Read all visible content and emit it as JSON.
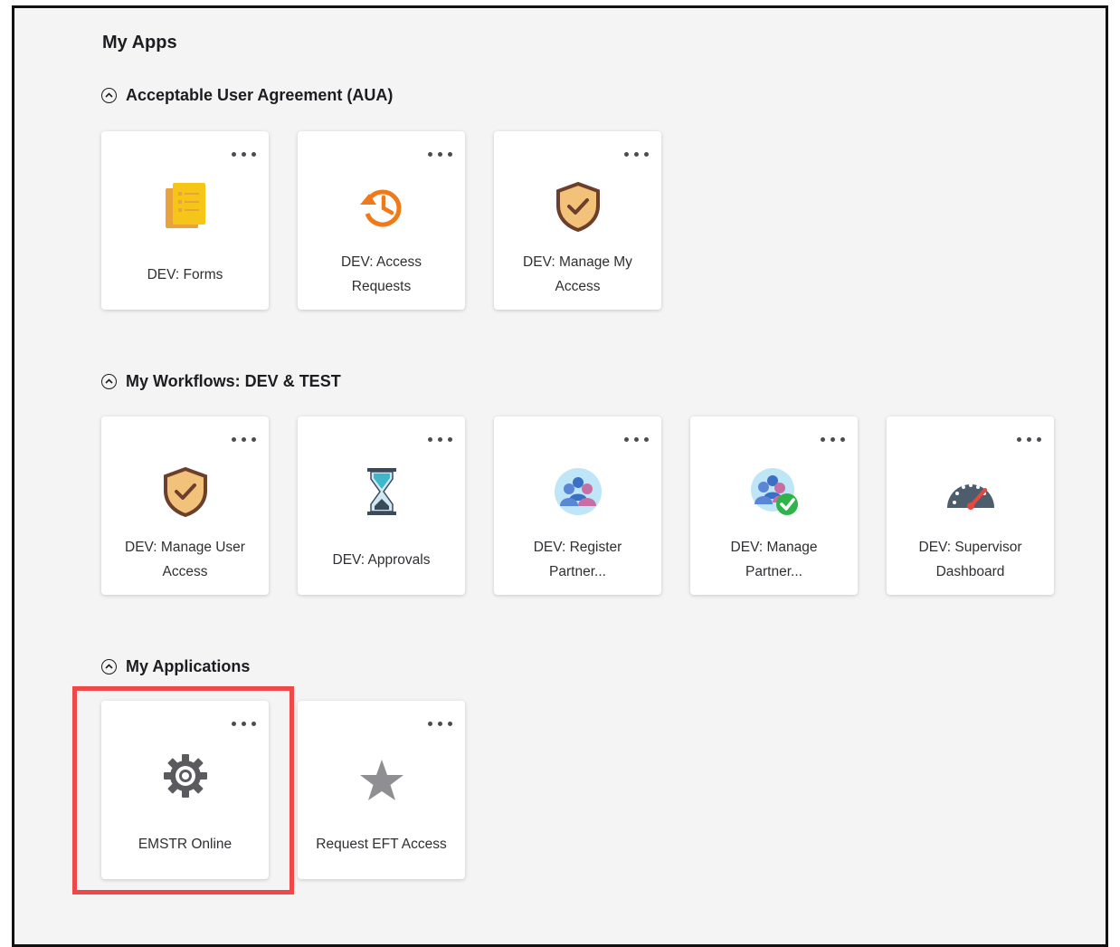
{
  "page_title": "My Apps",
  "sections": [
    {
      "title": "Acceptable User Agreement (AUA)",
      "apps": [
        {
          "label": "DEV: Forms",
          "icon": "forms-icon"
        },
        {
          "label": "DEV: Access Requests",
          "icon": "history-icon"
        },
        {
          "label": "DEV: Manage My Access",
          "icon": "shield-check-icon"
        }
      ]
    },
    {
      "title": "My Workflows: DEV & TEST",
      "apps": [
        {
          "label": "DEV: Manage User Access",
          "icon": "shield-check-icon"
        },
        {
          "label": "DEV: Approvals",
          "icon": "hourglass-icon"
        },
        {
          "label": "DEV: Register Partner...",
          "icon": "people-group-icon"
        },
        {
          "label": "DEV: Manage Partner...",
          "icon": "people-check-icon"
        },
        {
          "label": "DEV: Supervisor Dashboard",
          "icon": "speedometer-icon"
        }
      ]
    },
    {
      "title": "My Applications",
      "apps": [
        {
          "label": "EMSTR Online",
          "icon": "gear-icon"
        },
        {
          "label": "Request EFT Access",
          "icon": "star-icon"
        }
      ]
    }
  ],
  "colors": {
    "highlight": "#f04848",
    "background": "#f4f4f4",
    "card": "#ffffff"
  }
}
